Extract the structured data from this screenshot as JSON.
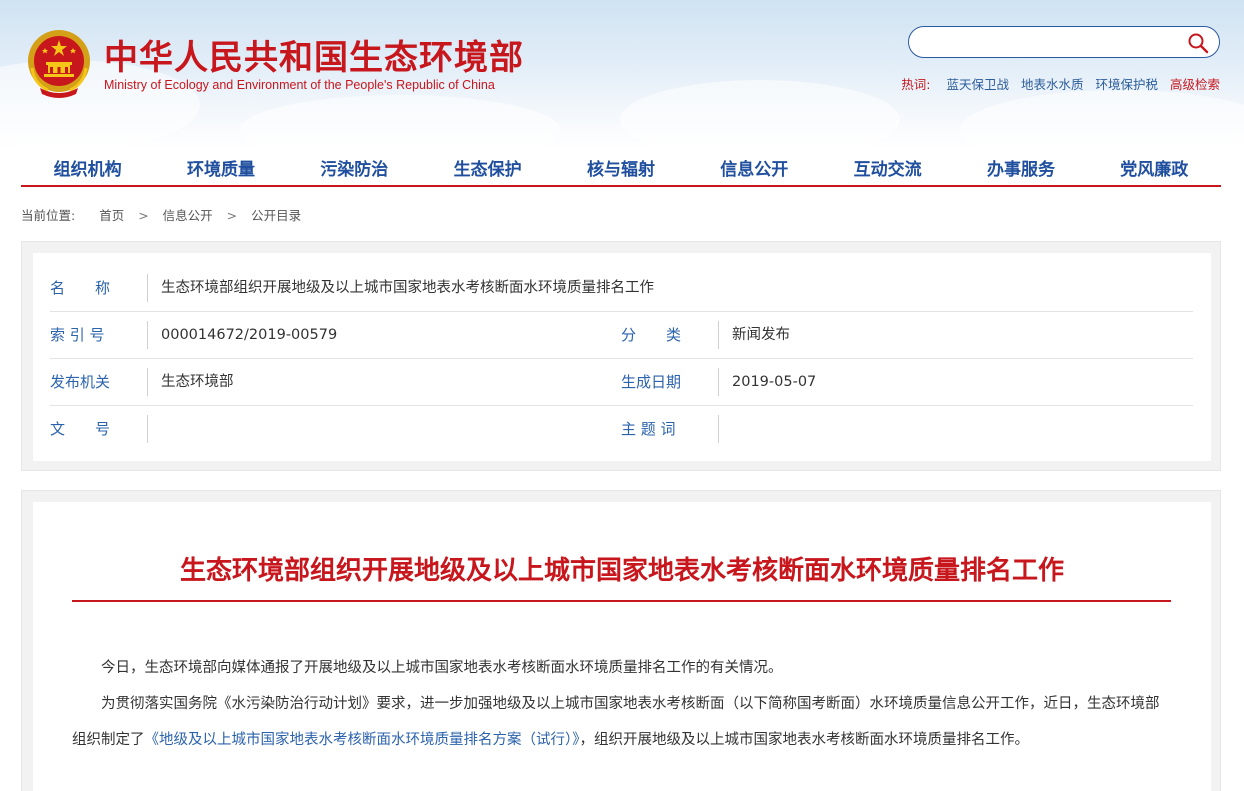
{
  "header": {
    "title": "中华人民共和国生态环境部",
    "subtitle": "Ministry of Ecology and Environment of the People's Republic of China",
    "search_placeholder": "",
    "hot_label": "热词:",
    "hot_words": [
      "蓝天保卫战",
      "地表水水质",
      "环境保护税"
    ],
    "advanced_search": "高级检索"
  },
  "nav": {
    "items": [
      "组织机构",
      "环境质量",
      "污染防治",
      "生态保护",
      "核与辐射",
      "信息公开",
      "互动交流",
      "办事服务",
      "党风廉政"
    ]
  },
  "breadcrumb": {
    "label": "当前位置:",
    "items": [
      "首页",
      "信息公开",
      "公开目录"
    ],
    "separator": ">"
  },
  "meta": {
    "name_label": "名　　称",
    "name_value": "生态环境部组织开展地级及以上城市国家地表水考核断面水环境质量排名工作",
    "index_label": "索 引 号",
    "index_value": "000014672/2019-00579",
    "category_label": "分　　类",
    "category_value": "新闻发布",
    "issuer_label": "发布机关",
    "issuer_value": "生态环境部",
    "date_label": "生成日期",
    "date_value": "2019-05-07",
    "docno_label": "文　　号",
    "docno_value": "",
    "keywords_label": "主 题 词",
    "keywords_value": ""
  },
  "article": {
    "title": "生态环境部组织开展地级及以上城市国家地表水考核断面水环境质量排名工作",
    "p1": "今日，生态环境部向媒体通报了开展地级及以上城市国家地表水考核断面水环境质量排名工作的有关情况。",
    "p2_before": "为贯彻落实国务院《水污染防治行动计划》要求，进一步加强地级及以上城市国家地表水考核断面（以下简称国考断面）水环境质量信息公开工作，近日，生态环境部组织制定了",
    "p2_link": "《地级及以上城市国家地表水考核断面水环境质量排名方案（试行）》",
    "p2_after": "，组织开展地级及以上城市国家地表水考核断面水环境质量排名工作。"
  },
  "colors": {
    "brand_red": "#c8161d",
    "nav_blue": "#1f4f9e",
    "label_blue": "#2c63ad"
  }
}
